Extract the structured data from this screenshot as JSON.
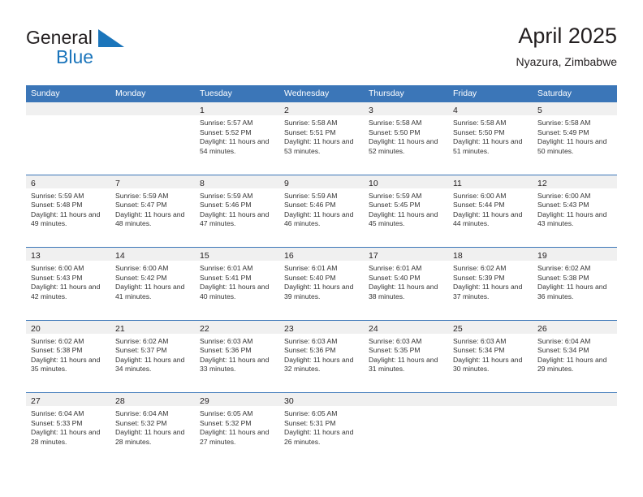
{
  "brand": {
    "name_part1": "General",
    "name_part2": "Blue",
    "triangle_color": "#1b75bb"
  },
  "header": {
    "title": "April 2025",
    "location": "Nyazura, Zimbabwe"
  },
  "colors": {
    "header_blue": "#3b76b8",
    "row_divider": "#3b76b8",
    "daynum_band": "#f0f0f0",
    "text": "#231f20"
  },
  "weekday_headers": [
    "Sunday",
    "Monday",
    "Tuesday",
    "Wednesday",
    "Thursday",
    "Friday",
    "Saturday"
  ],
  "weeks": [
    [
      {
        "day": "",
        "sunrise": "",
        "sunset": "",
        "daylight": ""
      },
      {
        "day": "",
        "sunrise": "",
        "sunset": "",
        "daylight": ""
      },
      {
        "day": "1",
        "sunrise": "Sunrise: 5:57 AM",
        "sunset": "Sunset: 5:52 PM",
        "daylight": "Daylight: 11 hours and 54 minutes."
      },
      {
        "day": "2",
        "sunrise": "Sunrise: 5:58 AM",
        "sunset": "Sunset: 5:51 PM",
        "daylight": "Daylight: 11 hours and 53 minutes."
      },
      {
        "day": "3",
        "sunrise": "Sunrise: 5:58 AM",
        "sunset": "Sunset: 5:50 PM",
        "daylight": "Daylight: 11 hours and 52 minutes."
      },
      {
        "day": "4",
        "sunrise": "Sunrise: 5:58 AM",
        "sunset": "Sunset: 5:50 PM",
        "daylight": "Daylight: 11 hours and 51 minutes."
      },
      {
        "day": "5",
        "sunrise": "Sunrise: 5:58 AM",
        "sunset": "Sunset: 5:49 PM",
        "daylight": "Daylight: 11 hours and 50 minutes."
      }
    ],
    [
      {
        "day": "6",
        "sunrise": "Sunrise: 5:59 AM",
        "sunset": "Sunset: 5:48 PM",
        "daylight": "Daylight: 11 hours and 49 minutes."
      },
      {
        "day": "7",
        "sunrise": "Sunrise: 5:59 AM",
        "sunset": "Sunset: 5:47 PM",
        "daylight": "Daylight: 11 hours and 48 minutes."
      },
      {
        "day": "8",
        "sunrise": "Sunrise: 5:59 AM",
        "sunset": "Sunset: 5:46 PM",
        "daylight": "Daylight: 11 hours and 47 minutes."
      },
      {
        "day": "9",
        "sunrise": "Sunrise: 5:59 AM",
        "sunset": "Sunset: 5:46 PM",
        "daylight": "Daylight: 11 hours and 46 minutes."
      },
      {
        "day": "10",
        "sunrise": "Sunrise: 5:59 AM",
        "sunset": "Sunset: 5:45 PM",
        "daylight": "Daylight: 11 hours and 45 minutes."
      },
      {
        "day": "11",
        "sunrise": "Sunrise: 6:00 AM",
        "sunset": "Sunset: 5:44 PM",
        "daylight": "Daylight: 11 hours and 44 minutes."
      },
      {
        "day": "12",
        "sunrise": "Sunrise: 6:00 AM",
        "sunset": "Sunset: 5:43 PM",
        "daylight": "Daylight: 11 hours and 43 minutes."
      }
    ],
    [
      {
        "day": "13",
        "sunrise": "Sunrise: 6:00 AM",
        "sunset": "Sunset: 5:43 PM",
        "daylight": "Daylight: 11 hours and 42 minutes."
      },
      {
        "day": "14",
        "sunrise": "Sunrise: 6:00 AM",
        "sunset": "Sunset: 5:42 PM",
        "daylight": "Daylight: 11 hours and 41 minutes."
      },
      {
        "day": "15",
        "sunrise": "Sunrise: 6:01 AM",
        "sunset": "Sunset: 5:41 PM",
        "daylight": "Daylight: 11 hours and 40 minutes."
      },
      {
        "day": "16",
        "sunrise": "Sunrise: 6:01 AM",
        "sunset": "Sunset: 5:40 PM",
        "daylight": "Daylight: 11 hours and 39 minutes."
      },
      {
        "day": "17",
        "sunrise": "Sunrise: 6:01 AM",
        "sunset": "Sunset: 5:40 PM",
        "daylight": "Daylight: 11 hours and 38 minutes."
      },
      {
        "day": "18",
        "sunrise": "Sunrise: 6:02 AM",
        "sunset": "Sunset: 5:39 PM",
        "daylight": "Daylight: 11 hours and 37 minutes."
      },
      {
        "day": "19",
        "sunrise": "Sunrise: 6:02 AM",
        "sunset": "Sunset: 5:38 PM",
        "daylight": "Daylight: 11 hours and 36 minutes."
      }
    ],
    [
      {
        "day": "20",
        "sunrise": "Sunrise: 6:02 AM",
        "sunset": "Sunset: 5:38 PM",
        "daylight": "Daylight: 11 hours and 35 minutes."
      },
      {
        "day": "21",
        "sunrise": "Sunrise: 6:02 AM",
        "sunset": "Sunset: 5:37 PM",
        "daylight": "Daylight: 11 hours and 34 minutes."
      },
      {
        "day": "22",
        "sunrise": "Sunrise: 6:03 AM",
        "sunset": "Sunset: 5:36 PM",
        "daylight": "Daylight: 11 hours and 33 minutes."
      },
      {
        "day": "23",
        "sunrise": "Sunrise: 6:03 AM",
        "sunset": "Sunset: 5:36 PM",
        "daylight": "Daylight: 11 hours and 32 minutes."
      },
      {
        "day": "24",
        "sunrise": "Sunrise: 6:03 AM",
        "sunset": "Sunset: 5:35 PM",
        "daylight": "Daylight: 11 hours and 31 minutes."
      },
      {
        "day": "25",
        "sunrise": "Sunrise: 6:03 AM",
        "sunset": "Sunset: 5:34 PM",
        "daylight": "Daylight: 11 hours and 30 minutes."
      },
      {
        "day": "26",
        "sunrise": "Sunrise: 6:04 AM",
        "sunset": "Sunset: 5:34 PM",
        "daylight": "Daylight: 11 hours and 29 minutes."
      }
    ],
    [
      {
        "day": "27",
        "sunrise": "Sunrise: 6:04 AM",
        "sunset": "Sunset: 5:33 PM",
        "daylight": "Daylight: 11 hours and 28 minutes."
      },
      {
        "day": "28",
        "sunrise": "Sunrise: 6:04 AM",
        "sunset": "Sunset: 5:32 PM",
        "daylight": "Daylight: 11 hours and 28 minutes."
      },
      {
        "day": "29",
        "sunrise": "Sunrise: 6:05 AM",
        "sunset": "Sunset: 5:32 PM",
        "daylight": "Daylight: 11 hours and 27 minutes."
      },
      {
        "day": "30",
        "sunrise": "Sunrise: 6:05 AM",
        "sunset": "Sunset: 5:31 PM",
        "daylight": "Daylight: 11 hours and 26 minutes."
      },
      {
        "day": "",
        "sunrise": "",
        "sunset": "",
        "daylight": ""
      },
      {
        "day": "",
        "sunrise": "",
        "sunset": "",
        "daylight": ""
      },
      {
        "day": "",
        "sunrise": "",
        "sunset": "",
        "daylight": ""
      }
    ]
  ]
}
